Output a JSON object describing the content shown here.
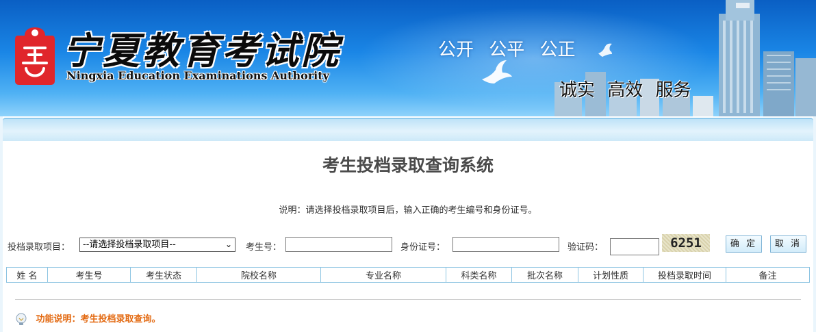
{
  "header": {
    "title_cn": "宁夏教育考试院",
    "title_en": "Ningxia Education Examinations Authority",
    "slogan_top": "公开 公平 公正",
    "slogan_bottom": "诚实 高效 服务",
    "brand_color": "#1a86e6"
  },
  "page": {
    "title": "考生投档录取查询系统",
    "hint": "说明：请选择投档录取项目后，输入正确的考生编号和身份证号。"
  },
  "form": {
    "project_label": "投档录取项目：",
    "project_selected": "--请选择投档录取项目--",
    "exam_no_label": "考生号：",
    "id_label": "身份证号：",
    "captcha_label": "验证码：",
    "captcha_value": "6251",
    "confirm_label": "确 定",
    "cancel_label": "取 消"
  },
  "table": {
    "columns": [
      "姓 名",
      "考生号",
      "考生状态",
      "院校名称",
      "专业名称",
      "科类名称",
      "批次名称",
      "计划性质",
      "投档录取时间",
      "备注"
    ]
  },
  "footer": {
    "function_note": "功能说明：考生投档录取查询。",
    "note_color": "#e36a12"
  }
}
